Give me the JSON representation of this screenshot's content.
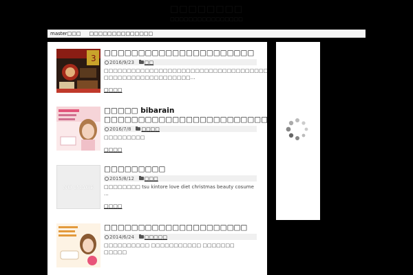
{
  "site": {
    "title": "□□□□□□□□",
    "description": "□□□□□□□□□□□□□□□□"
  },
  "nav": {
    "items": [
      "master□□□",
      "□□□□□□□□□□□□□□"
    ]
  },
  "posts": [
    {
      "title": "□□□□□□□□□□□□□□□□□□□□□□",
      "date": "2016/9/23",
      "category": "□□",
      "excerpt": "□□□□□□□□□□□□□□□□□□□□□□□□□□□□□□□□□□□□□□□□□□□□ □□□□□□□□□□□□□□□□□□□…",
      "more": "□□□□",
      "thumb": "photo"
    },
    {
      "title": "□□□□□ bibarain □□□□□□□□□□□□□□□□□□□□□□□□□□□□□□",
      "date": "2016/7/8",
      "category": "□□□□",
      "excerpt": "□□□□□□□□□",
      "more": "□□□□",
      "thumb": "photo"
    },
    {
      "title": "□□□□□□□□□",
      "date": "2015/8/12",
      "category": "□□□",
      "excerpt": "□□□□□□□□ tsu kintore love diet christmas beauty cosume ...",
      "more": "□□□□",
      "thumb": "noimage",
      "thumb_text": "NO IMAGE"
    },
    {
      "title": "□□□□□□□□□□□□□□□□□□□□□",
      "date": "2014/6/24",
      "category": "□□□□□",
      "excerpt": "□□□□□□□□□□ □□□□□□□□□□□ □□□□□□□ □□□□□",
      "more": "",
      "thumb": "photo"
    }
  ],
  "colors": {
    "background": "#000000",
    "content": "#ffffff",
    "meta_bar": "#f0f0f0"
  }
}
